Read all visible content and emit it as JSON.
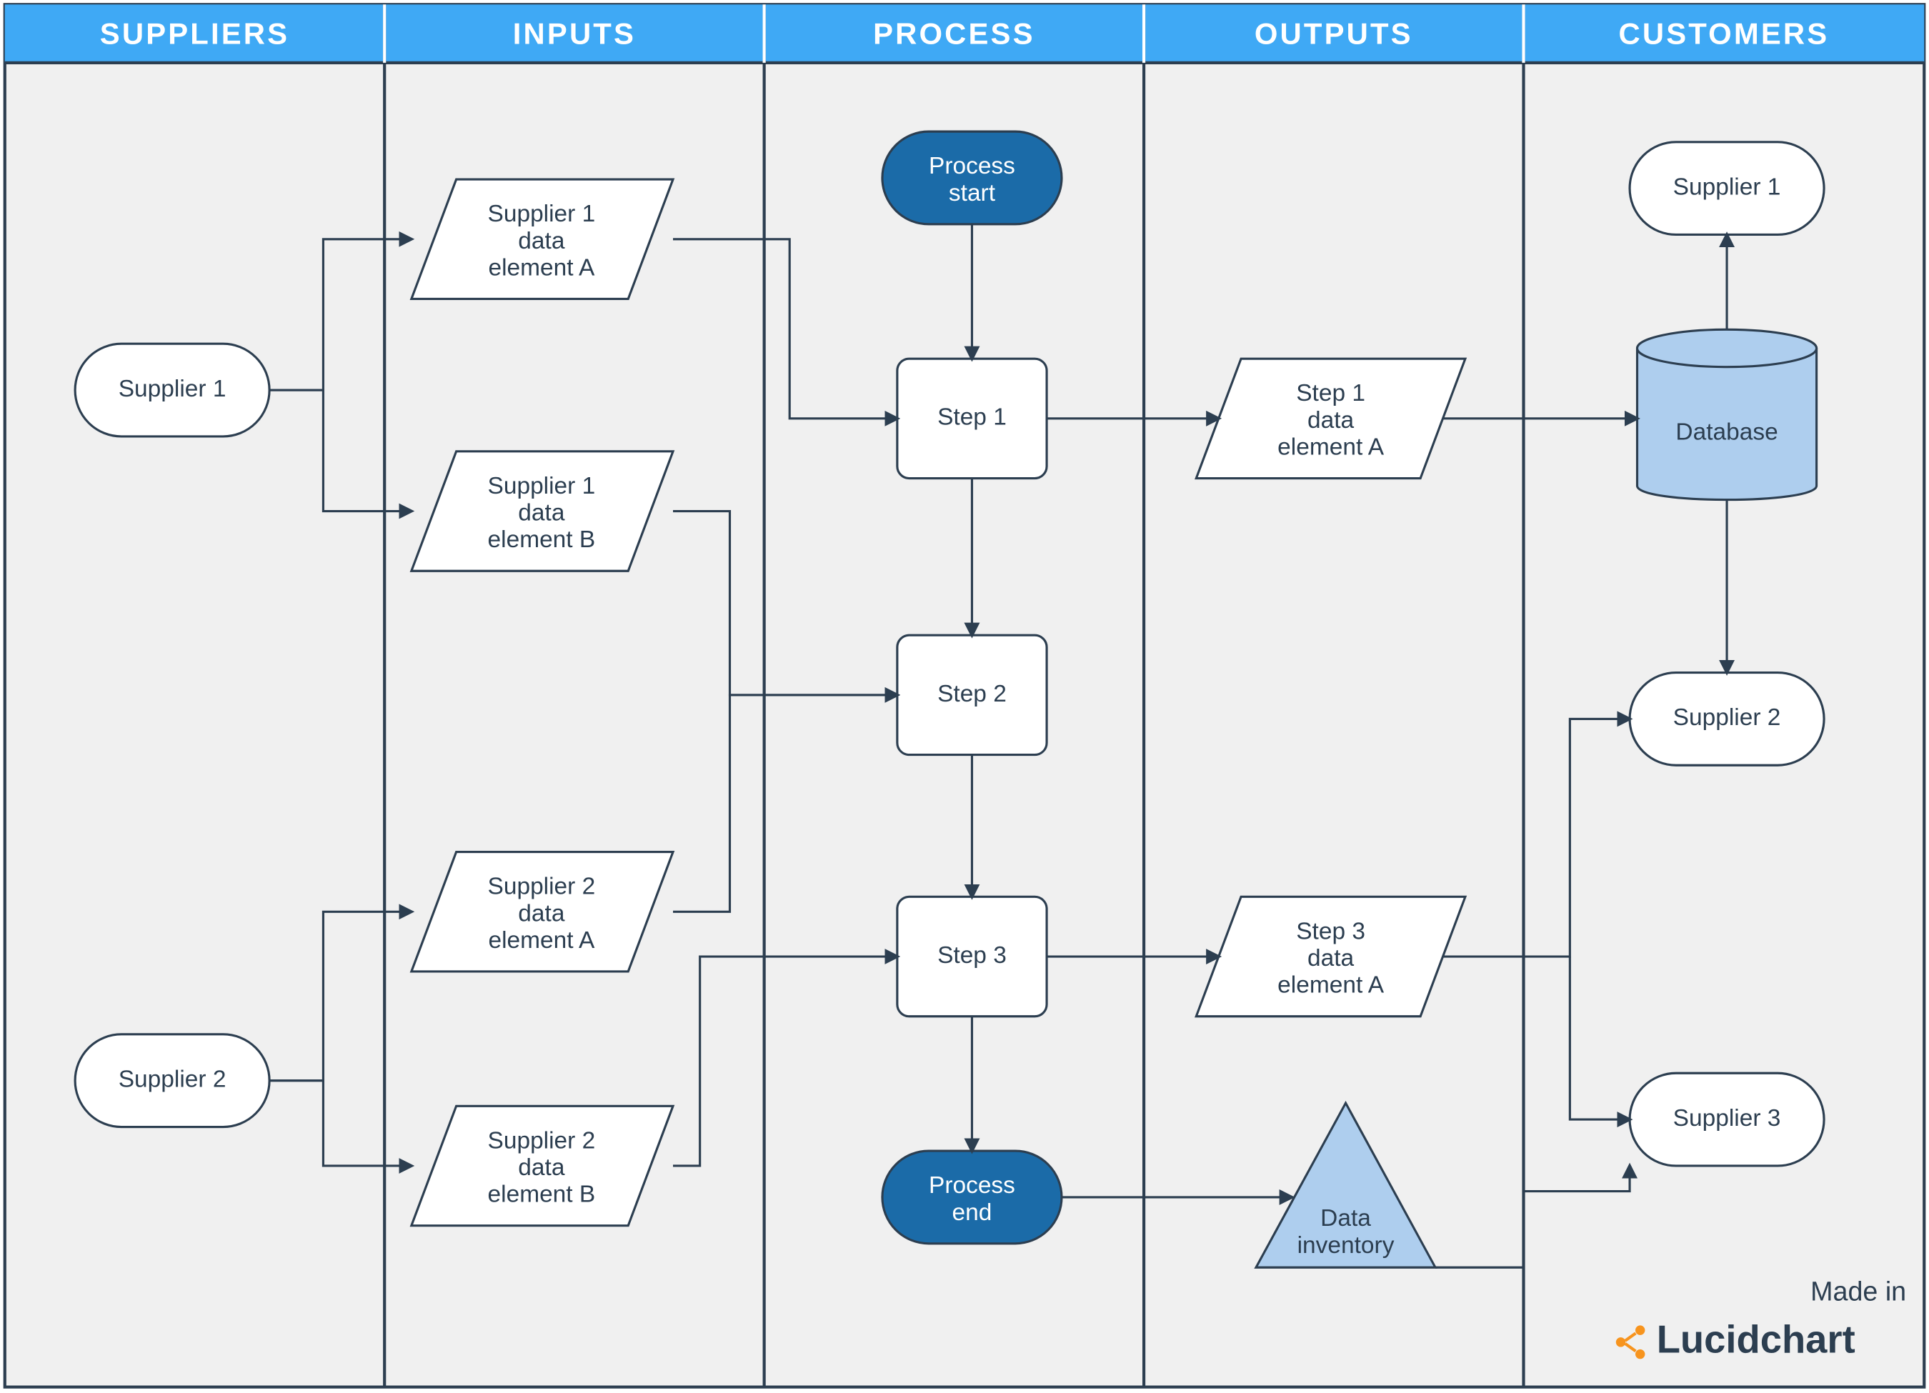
{
  "columns": {
    "suppliers": "SUPPLIERS",
    "inputs": "INPUTS",
    "process": "PROCESS",
    "outputs": "OUTPUTS",
    "customers": "CUSTOMERS"
  },
  "suppliers": {
    "s1": "Supplier 1",
    "s2": "Supplier 2"
  },
  "inputs": {
    "i1a_l1": "Supplier 1",
    "i1a_l2": "data",
    "i1a_l3": "element A",
    "i1b_l1": "Supplier 1",
    "i1b_l2": "data",
    "i1b_l3": "element B",
    "i2a_l1": "Supplier 2",
    "i2a_l2": "data",
    "i2a_l3": "element A",
    "i2b_l1": "Supplier 2",
    "i2b_l2": "data",
    "i2b_l3": "element B"
  },
  "process": {
    "start_l1": "Process",
    "start_l2": "start",
    "step1": "Step 1",
    "step2": "Step 2",
    "step3": "Step 3",
    "end_l1": "Process",
    "end_l2": "end"
  },
  "outputs": {
    "o1_l1": "Step 1",
    "o1_l2": "data",
    "o1_l3": "element A",
    "o3_l1": "Step 3",
    "o3_l2": "data",
    "o3_l3": "element A",
    "tri_l1": "Data",
    "tri_l2": "inventory"
  },
  "customers": {
    "c1": "Supplier 1",
    "db": "Database",
    "c2": "Supplier 2",
    "c3": "Supplier 3"
  },
  "branding": {
    "made_in": "Made in",
    "brand": "Lucidchart"
  }
}
